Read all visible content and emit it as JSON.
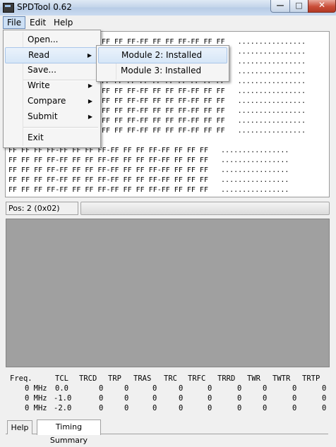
{
  "window": {
    "title": "SPDTool 0.62",
    "min_glyph": "—",
    "max_glyph": "□",
    "close_glyph": "✕"
  },
  "menubar": {
    "file": "File",
    "edit": "Edit",
    "help": "Help"
  },
  "file_menu": {
    "open": "Open...",
    "read": "Read",
    "save": "Save...",
    "write": "Write",
    "compare": "Compare",
    "submit": "Submit",
    "exit": "Exit",
    "arrow": "▶"
  },
  "read_submenu": {
    "module2": "Module 2: Installed",
    "module3": "Module 3: Installed"
  },
  "hex_lines": {
    "l1": "FF FF FF-FF FF FF FF-FF FF FF   ................",
    "l2": "FF FF FF-FF FF FF FF-FF FF FF   ................",
    "l3": "FF FF FF-FF FF FF FF-FF FF FF   ................",
    "l4": "FF FF FF-FF FF FF FF-FF FF FF   ................",
    "l5": "FF FF FF-FF FF FF FF-FF FF FF   ................",
    "l6": "FF FF FF-FF FF FF FF-FF FF FF   ................",
    "l7": "FF FF FF-FF FF FF FF-FF FF FF   ................",
    "l8": "FF FF FF-FF FF FF FF-FF FF FF   ................",
    "l9": "FF FF FF-FF FF FF FF-FF FF FF   ................",
    "l10": "FF FF FF-FF FF FF FF-FF FF FF   ................",
    "l11": "FF FF FF FF-FF FF FF FF-FF FF FF FF-FF FF FF FF   ................",
    "l12": "FF FF FF FF-FF FF FF FF-FF FF FF FF-FF FF FF FF   ................",
    "l13": "FF FF FF FF-FF FF FF FF-FF FF FF FF-FF FF FF FF   ................",
    "l14": "FF FF FF FF-FF FF FF FF-FF FF FF FF-FF FF FF FF   ................",
    "l15": "FF FF FF FF-FF FF FF FF-FF FF FF FF-FF FF FF FF   ................"
  },
  "status": {
    "pos": "Pos: 2 (0x02)",
    "progress": 0
  },
  "timing": {
    "headers": [
      "Freq.",
      "TCL",
      "TRCD",
      "TRP",
      "TRAS",
      "TRC",
      "TRFC",
      "TRRD",
      "TWR",
      "TWTR",
      "TRTP"
    ],
    "rows": [
      [
        "0 MHz",
        "0.0",
        "0",
        "0",
        "0",
        "0",
        "0",
        "0",
        "0",
        "0",
        "0"
      ],
      [
        "0 MHz",
        "-1.0",
        "0",
        "0",
        "0",
        "0",
        "0",
        "0",
        "0",
        "0",
        "0"
      ],
      [
        "0 MHz",
        "-2.0",
        "0",
        "0",
        "0",
        "0",
        "0",
        "0",
        "0",
        "0",
        "0"
      ]
    ]
  },
  "tabs": {
    "help": "Help",
    "timing_summary": "Timing Summary"
  }
}
